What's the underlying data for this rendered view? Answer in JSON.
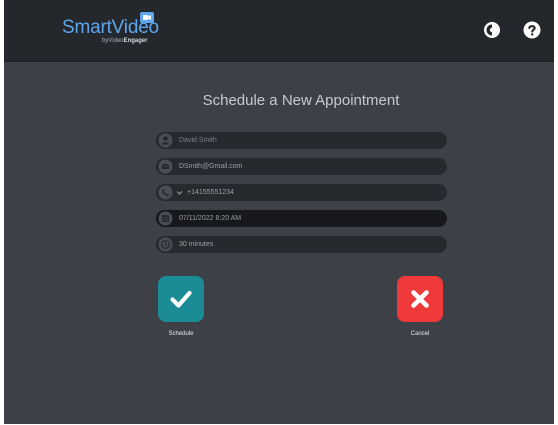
{
  "header": {
    "logo_main": "SmartVideo",
    "logo_by": "by",
    "logo_brand_light": "Video",
    "logo_brand_bold": "Engager",
    "icons": [
      "contrast-icon",
      "help-icon"
    ]
  },
  "page": {
    "title": "Schedule a New Appointment"
  },
  "form": {
    "name": "David Smith",
    "email": "DSmith@Gmail.com",
    "phone": "+14155551234",
    "datetime": "07/11/2022 8:20 AM",
    "duration": "30 minutes"
  },
  "actions": {
    "schedule_label": "Schedule",
    "cancel_label": "Cancel"
  },
  "colors": {
    "background": "#3d4147",
    "header": "#24272b",
    "accent_blue": "#5ea6ee",
    "schedule_teal": "#1b8c95",
    "cancel_red": "#f0393a"
  }
}
